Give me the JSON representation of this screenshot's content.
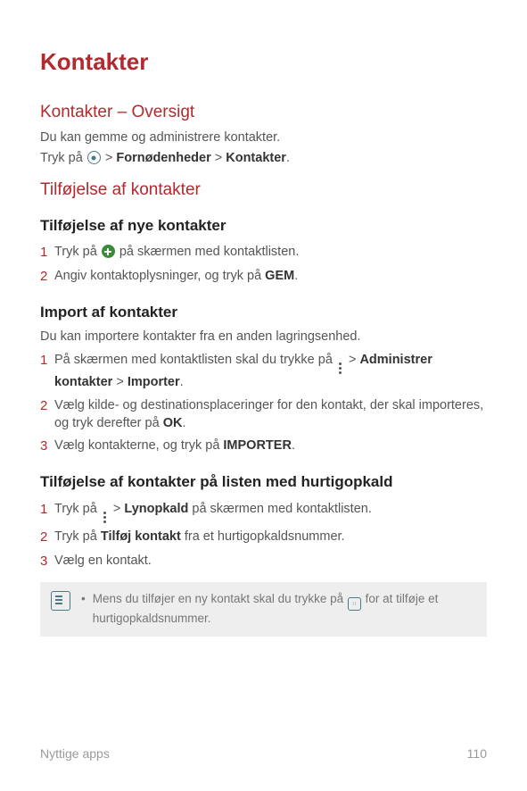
{
  "title": "Kontakter",
  "sec1": {
    "heading": "Kontakter – Oversigt",
    "intro": "Du kan gemme og administrere kontakter.",
    "path_pre": "Tryk på ",
    "path_b1": "Fornødenheder",
    "path_b2": "Kontakter"
  },
  "sec2_heading": "Tilføjelse af kontakter",
  "sub1": {
    "heading": "Tilføjelse af nye kontakter",
    "steps": {
      "s1a": "Tryk på ",
      "s1b": " på skærmen med kontaktlisten.",
      "s2a": "Angiv kontaktoplysninger, og tryk på ",
      "s2b": "GEM",
      "s2c": "."
    }
  },
  "sub2": {
    "heading": "Import af kontakter",
    "intro": "Du kan importere kontakter fra en anden lagringsenhed.",
    "s1a": "På skærmen med kontaktlisten skal du trykke på ",
    "s1b1": "Administrer kontakter",
    "s1b2": "Importer",
    "s2a": "Vælg kilde- og destinationsplaceringer for den kontakt, der skal importeres, og tryk derefter på ",
    "s2b": "OK",
    "s3a": "Vælg kontakterne, og tryk på ",
    "s3b": "IMPORTER"
  },
  "sub3": {
    "heading": "Tilføjelse af kontakter på listen med hurtigopkald",
    "s1a": "Tryk på ",
    "s1b": "Lynopkald",
    "s1c": " på skærmen med kontaktlisten.",
    "s2a": "Tryk på ",
    "s2b": "Tilføj kontakt",
    "s2c": " fra et hurtigopkaldsnummer.",
    "s3": "Vælg en kontakt."
  },
  "note": {
    "a": "Mens du tilføjer en ny kontakt skal du trykke på ",
    "b": " for at tilføje et hurtigopkaldsnummer."
  },
  "footer": {
    "left": "Nyttige apps",
    "right": "110"
  },
  "nums": {
    "n1": "1",
    "n2": "2",
    "n3": "3"
  },
  "gt": ">"
}
